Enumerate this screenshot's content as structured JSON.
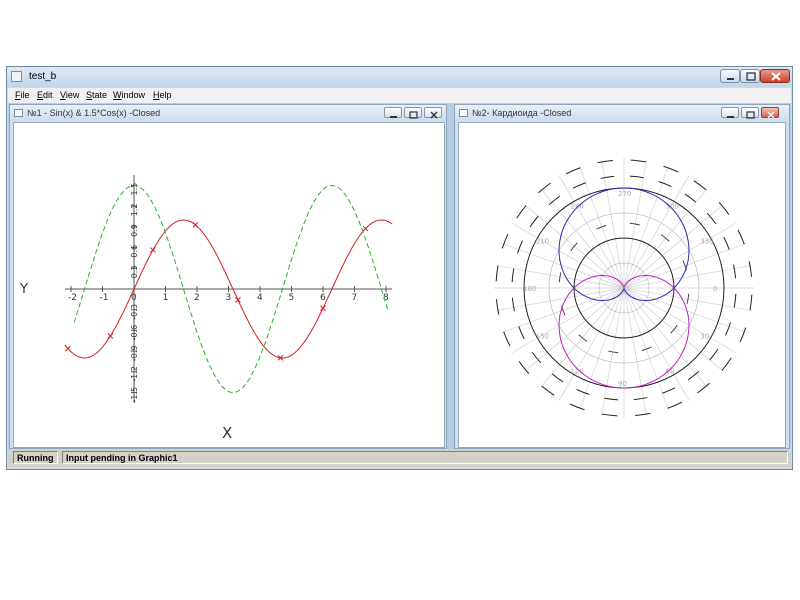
{
  "window": {
    "title": "test_b"
  },
  "menu": {
    "file": {
      "key": "F",
      "rest": "ile"
    },
    "edit": {
      "key": "E",
      "rest": "dit"
    },
    "view": {
      "key": "V",
      "rest": "iew"
    },
    "state": {
      "key": "S",
      "rest": "tate"
    },
    "window": {
      "key": "W",
      "rest": "indow"
    },
    "help": {
      "key": "H",
      "rest": "elp"
    }
  },
  "graphic1": {
    "caption": "№1 - Sin(x) & 1.5*Cos(x) -Closed",
    "y_axis_label": "Y",
    "x_axis_label": "X",
    "x_ticks": [
      "-2",
      "-1",
      "0",
      "1",
      "2",
      "3",
      "4",
      "5",
      "6",
      "7",
      "8"
    ],
    "y_ticks": [
      "1.5",
      "1.2",
      "0.9",
      "0.6",
      "0.3",
      "0",
      "-0.3",
      "-0.6",
      "-0.9",
      "-1.2",
      "-1.5"
    ]
  },
  "graphic2": {
    "caption": "№2- Кардиоида -Closed",
    "angle_labels": [
      "270",
      "300",
      "330",
      "0",
      "30",
      "60",
      "90",
      "120",
      "150",
      "180",
      "210",
      "240"
    ]
  },
  "status": {
    "state": "Running",
    "message": "Input pending in Graphic1"
  },
  "chart_data": [
    {
      "type": "line",
      "x_range": [
        -2,
        8
      ],
      "y_range": [
        -1.5,
        1.5
      ],
      "series": [
        {
          "formula": "sin(x)",
          "color": "#d42020",
          "style": "solid",
          "markers": "x"
        },
        {
          "formula": "1.5*cos(x)",
          "color": "#22b422",
          "style": "dashed"
        }
      ],
      "grid": false
    },
    {
      "type": "polar",
      "series": [
        {
          "formula": "cardioid (upper)",
          "color": "#2a2ab8"
        },
        {
          "formula": "cardioid (lower)",
          "color": "#c020c0"
        }
      ],
      "grid": true
    }
  ]
}
